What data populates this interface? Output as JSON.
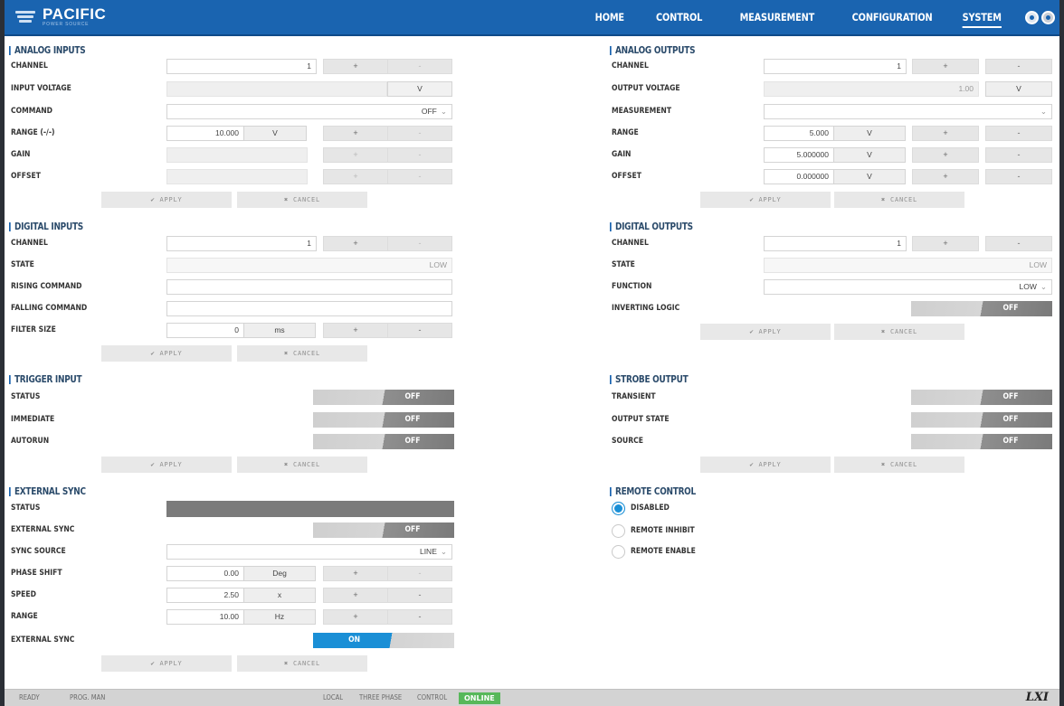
{
  "brand": {
    "name": "PACIFIC",
    "tagline": "POWER SOURCE"
  },
  "nav": {
    "items": [
      "HOME",
      "CONTROL",
      "MEASUREMENT",
      "CONFIGURATION",
      "SYSTEM"
    ],
    "active": "SYSTEM"
  },
  "colors": {
    "header": "#1a64b0",
    "accent": "#1a8fd6",
    "online": "#57b85a"
  },
  "common": {
    "plus": "+",
    "minus": "-",
    "apply": "APPLY",
    "cancel": "CANCEL",
    "apply_icon": "✔",
    "cancel_icon": "✖"
  },
  "analog_inputs": {
    "title": "ANALOG INPUTS",
    "channel": {
      "label": "CHANNEL",
      "value": "1"
    },
    "input_voltage": {
      "label": "INPUT VOLTAGE",
      "unit": "V"
    },
    "command": {
      "label": "COMMAND",
      "value": "OFF"
    },
    "range": {
      "label": "RANGE (-/-)",
      "value": "10.000",
      "unit": "V"
    },
    "gain": {
      "label": "GAIN"
    },
    "offset": {
      "label": "OFFSET"
    }
  },
  "analog_outputs": {
    "title": "ANALOG OUTPUTS",
    "channel": {
      "label": "CHANNEL",
      "value": "1"
    },
    "output_voltage": {
      "label": "OUTPUT VOLTAGE",
      "value": "1.00",
      "unit": "V"
    },
    "measurement": {
      "label": "MEASUREMENT"
    },
    "range": {
      "label": "RANGE",
      "value": "5.000",
      "unit": "V"
    },
    "gain": {
      "label": "GAIN",
      "value": "5.000000",
      "unit": "V"
    },
    "offset": {
      "label": "OFFSET",
      "value": "0.000000",
      "unit": "V"
    }
  },
  "digital_inputs": {
    "title": "DIGITAL INPUTS",
    "channel": {
      "label": "CHANNEL",
      "value": "1"
    },
    "state": {
      "label": "STATE",
      "value": "LOW"
    },
    "rising": {
      "label": "RISING COMMAND"
    },
    "falling": {
      "label": "FALLING COMMAND"
    },
    "filter": {
      "label": "FILTER SIZE",
      "value": "0",
      "unit": "ms"
    }
  },
  "digital_outputs": {
    "title": "DIGITAL OUTPUTS",
    "channel": {
      "label": "CHANNEL",
      "value": "1"
    },
    "state": {
      "label": "STATE",
      "value": "LOW"
    },
    "function": {
      "label": "FUNCTION",
      "value": "LOW"
    },
    "inverting": {
      "label": "INVERTING LOGIC",
      "value": "OFF"
    }
  },
  "trigger_input": {
    "title": "TRIGGER INPUT",
    "status": {
      "label": "STATUS",
      "value": "OFF"
    },
    "immediate": {
      "label": "IMMEDIATE",
      "value": "OFF"
    },
    "autorun": {
      "label": "AUTORUN",
      "value": "OFF"
    }
  },
  "strobe_output": {
    "title": "STROBE OUTPUT",
    "transient": {
      "label": "TRANSIENT",
      "value": "OFF"
    },
    "output_state": {
      "label": "OUTPUT STATE",
      "value": "OFF"
    },
    "source": {
      "label": "SOURCE",
      "value": "OFF"
    }
  },
  "external_sync": {
    "title": "EXTERNAL SYNC",
    "status": {
      "label": "STATUS"
    },
    "external_sync": {
      "label": "EXTERNAL SYNC",
      "value": "OFF"
    },
    "sync_source": {
      "label": "SYNC SOURCE",
      "value": "LINE"
    },
    "phase_shift": {
      "label": "PHASE SHIFT",
      "value": "0.00",
      "unit": "Deg"
    },
    "speed": {
      "label": "SPEED",
      "value": "2.50",
      "unit": "x"
    },
    "range": {
      "label": "RANGE",
      "value": "10.00",
      "unit": "Hz"
    },
    "external_sync_2": {
      "label": "EXTERNAL SYNC",
      "value": "ON"
    }
  },
  "remote_control": {
    "title": "REMOTE CONTROL",
    "options": [
      "DISABLED",
      "REMOTE INHIBIT",
      "REMOTE ENABLE"
    ],
    "selected": "DISABLED"
  },
  "footer": {
    "ready": "READY",
    "prog_man": "PROG. MAN",
    "local": "LOCAL",
    "three_phase": "THREE PHASE",
    "control": "CONTROL",
    "online": "ONLINE",
    "lxi": "LXI"
  }
}
